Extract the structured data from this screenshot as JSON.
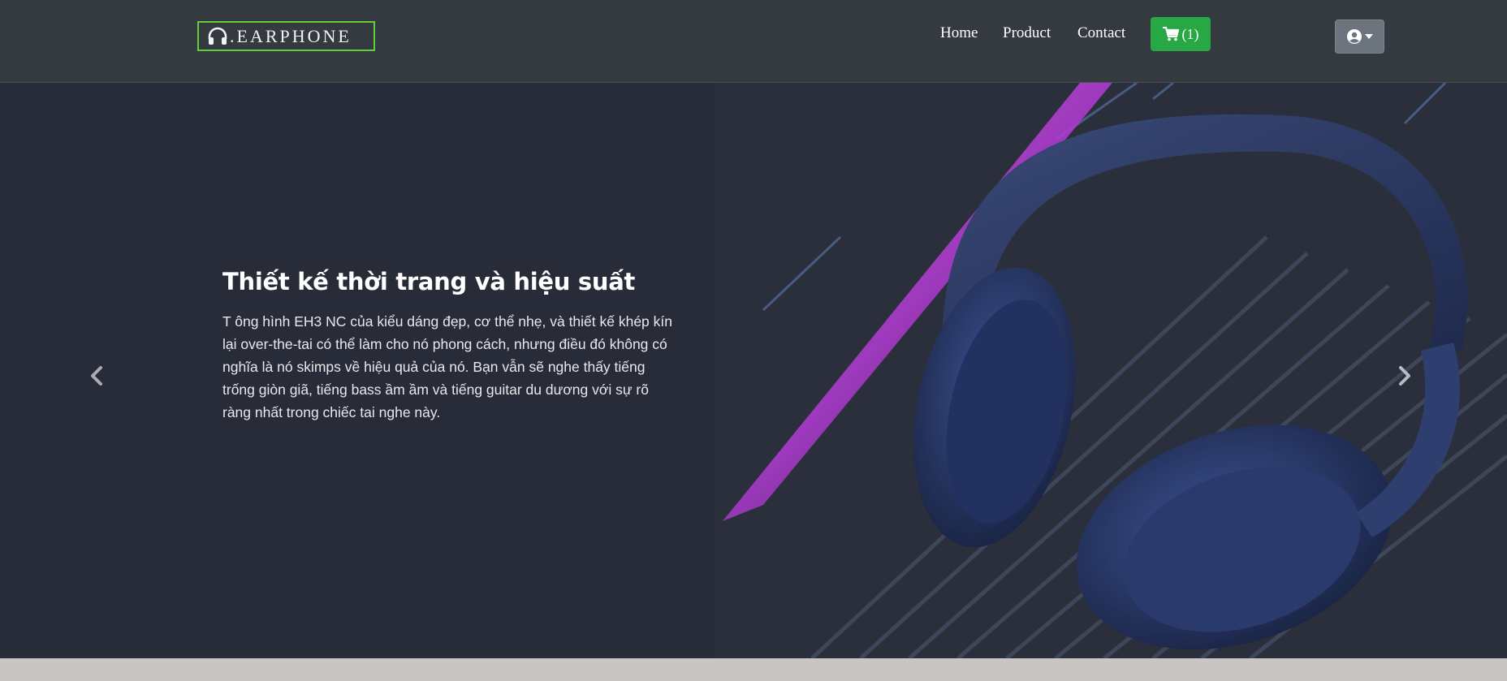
{
  "navbar": {
    "brand": ".EARPHONE",
    "links": [
      "Home",
      "Product",
      "Contact"
    ],
    "cart_label": "(1)"
  },
  "hero": {
    "title": "Thiết kế thời trang và hiệu suất",
    "description": "T ông hình EH3 NC của kiểu dáng đẹp, cơ thể nhẹ, và thiết kế khép kín lại over-the-tai có thể làm cho nó phong cách, nhưng điều đó không có nghĩa là nó skimps về hiệu quả của nó. Bạn vẫn sẽ nghe thấy tiếng trống giòn giã, tiếng bass ầm ầm và tiếng guitar du dương với sự rõ ràng nhất trong chiếc tai nghe này."
  },
  "colors": {
    "navbar_bg": "#343a40",
    "brand_border": "#5fcf3a",
    "cart_button": "#28a745",
    "user_button": "#6c757d",
    "hero_bg": "#272c38"
  },
  "icons": [
    "headphones-icon",
    "shopping-cart-icon",
    "user-circle-icon",
    "caret-down-icon",
    "chevron-left-icon",
    "chevron-right-icon"
  ]
}
